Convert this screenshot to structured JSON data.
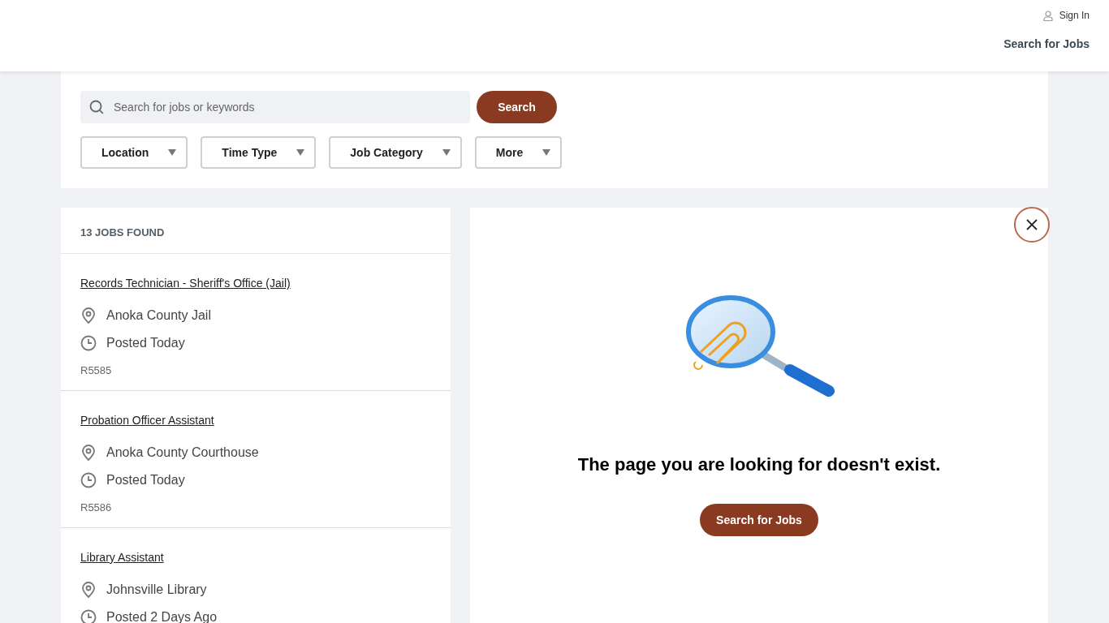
{
  "header": {
    "sign_in": "Sign In",
    "nav_link": "Search for Jobs"
  },
  "search": {
    "placeholder": "Search for jobs or keywords",
    "button": "Search"
  },
  "filters": [
    {
      "label": "Location"
    },
    {
      "label": "Time Type"
    },
    {
      "label": "Job Category"
    },
    {
      "label": "More"
    }
  ],
  "results": {
    "count": "13 JOBS FOUND",
    "jobs": [
      {
        "title": "Records Technician - Sheriff's Office (Jail)",
        "location": "Anoka County Jail",
        "posted": "Posted Today",
        "id": "R5585"
      },
      {
        "title": "Probation Officer Assistant",
        "location": "Anoka County Courthouse",
        "posted": "Posted Today",
        "id": "R5586"
      },
      {
        "title": "Library Assistant",
        "location": "Johnsville Library",
        "posted": "Posted 2 Days Ago"
      }
    ]
  },
  "detail": {
    "message": "The page you are looking for doesn't exist.",
    "button": "Search for Jobs"
  }
}
